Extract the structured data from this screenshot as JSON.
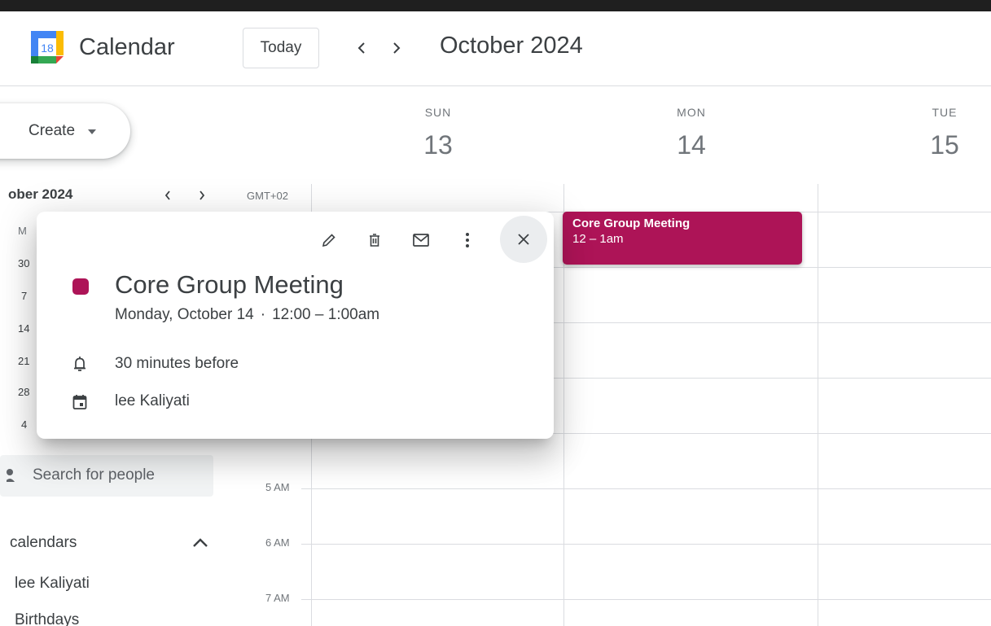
{
  "header": {
    "logo_day": "18",
    "app_title": "Calendar",
    "today_label": "Today",
    "month_title": "October 2024",
    "prev_icon": "chevron-left-icon",
    "next_icon": "chevron-right-icon"
  },
  "sidebar": {
    "create_label": "Create",
    "mini_month_label": "ober 2024",
    "timezone": "GMT+02",
    "mini_dow": "M",
    "mini_days": [
      "30",
      "7",
      "14",
      "21",
      "28",
      "4"
    ],
    "search_people_placeholder": "Search for people",
    "section_title": "calendars",
    "calendars": [
      "lee Kaliyati",
      "Birthdays"
    ]
  },
  "grid": {
    "days": [
      {
        "dow": "SUN",
        "num": "13"
      },
      {
        "dow": "MON",
        "num": "14"
      },
      {
        "dow": "TUE",
        "num": "15"
      }
    ],
    "hour_labels": [
      "5 AM",
      "6 AM",
      "7 AM"
    ]
  },
  "event": {
    "title": "Core Group Meeting",
    "time": "12 – 1am",
    "color": "#ad1457"
  },
  "popover": {
    "title": "Core Group Meeting",
    "date": "Monday, October 14",
    "separator": "·",
    "time": "12:00 – 1:00am",
    "reminder": "30 minutes before",
    "calendar_owner": "lee Kaliyati",
    "toolbar_icons": [
      "edit-icon",
      "delete-icon",
      "email-icon",
      "more-options-icon"
    ],
    "close_icon": "close-icon"
  }
}
